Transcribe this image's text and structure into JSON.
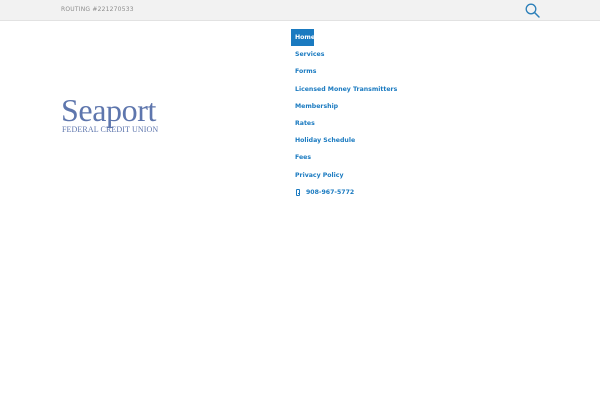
{
  "topbar": {
    "routing_text": "ROUTING #221270533",
    "search_icon": "search-icon"
  },
  "logo": {
    "name": "Seaport",
    "subtitle": "FEDERAL CREDIT UNION",
    "color": "#5e76ad"
  },
  "nav": {
    "accent_color": "#1a7ac0",
    "items": [
      {
        "label": "Home"
      },
      {
        "label": "Services"
      },
      {
        "label": "Forms"
      },
      {
        "label": "Licensed Money Transmitters"
      },
      {
        "label": "Membership"
      },
      {
        "label": "Rates"
      },
      {
        "label": "Holiday Schedule"
      },
      {
        "label": "Fees"
      },
      {
        "label": "Privacy Policy"
      }
    ],
    "phone": {
      "icon": "mobile-phone-icon",
      "number": "908-967-5772"
    }
  }
}
